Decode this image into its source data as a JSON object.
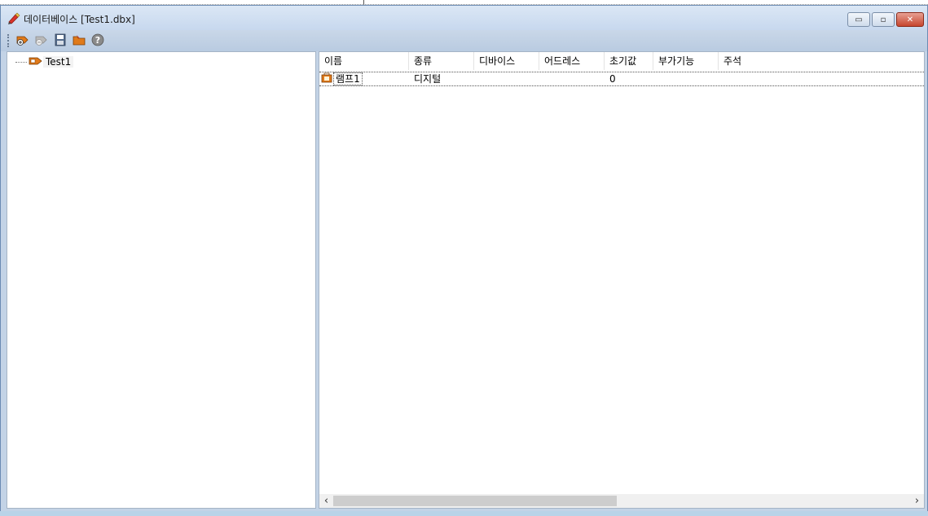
{
  "window": {
    "title": "데이터베이스 [Test1.dbx]",
    "controls": {
      "minimize": "▭",
      "maximize": "▫",
      "close": "✕"
    }
  },
  "toolbar": {
    "buttons": [
      {
        "name": "add-item-icon"
      },
      {
        "name": "delete-item-icon"
      },
      {
        "name": "save-icon"
      },
      {
        "name": "open-folder-icon"
      },
      {
        "name": "help-icon"
      }
    ]
  },
  "tree": {
    "root_label": "Test1"
  },
  "list": {
    "columns": [
      "이름",
      "종류",
      "디바이스",
      "어드레스",
      "초기값",
      "부가기능",
      "주석"
    ],
    "rows": [
      {
        "name": "램프1",
        "type": "디지털",
        "device": "",
        "address": "",
        "initial": "0",
        "extra": "",
        "comment": ""
      }
    ]
  },
  "scrollbar": {
    "left_arrow": "‹",
    "right_arrow": "›"
  },
  "colors": {
    "accent": "#c3d3e6",
    "close": "#c6462f",
    "icon_orange": "#e07a1a"
  }
}
